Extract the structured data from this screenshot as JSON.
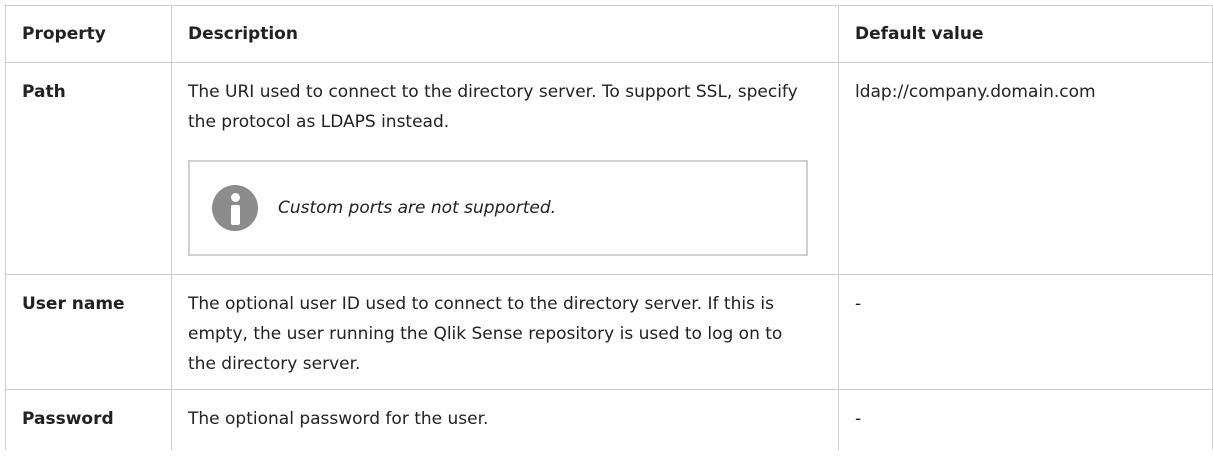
{
  "table": {
    "headers": {
      "property": "Property",
      "description": "Description",
      "default": "Default value"
    },
    "rows": [
      {
        "property": "Path",
        "description": "The URI used to connect to the directory server. To support SSL, specify the protocol as LDAPS instead.",
        "note": "Custom ports are not supported.",
        "note_icon": "info-icon",
        "default": "ldap://company.domain.com"
      },
      {
        "property": "User name",
        "description": "The optional user ID used to connect to the directory server. If this is empty, the user running the Qlik Sense repository is used to log on to the directory server.",
        "default": "-"
      },
      {
        "property": "Password",
        "description": "The optional password for the user.",
        "default": "-"
      }
    ]
  }
}
